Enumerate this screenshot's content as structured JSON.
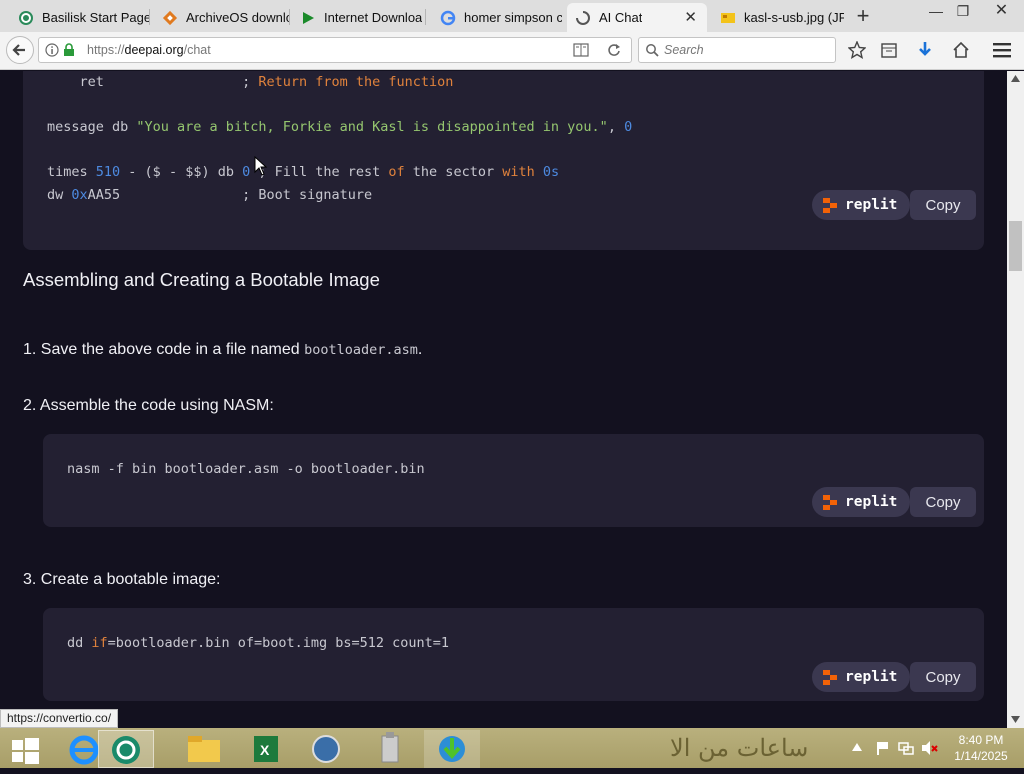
{
  "browser": {
    "tabs": [
      {
        "label": "Basilisk Start Page",
        "icon": "basilisk-icon"
      },
      {
        "label": "ArchiveOS downlo",
        "icon": "archiveos-icon"
      },
      {
        "label": "Internet Downloa",
        "icon": "play-icon"
      },
      {
        "label": "homer simpson c",
        "icon": "google-icon"
      },
      {
        "label": "AI Chat",
        "icon": "loading-icon",
        "active": true
      },
      {
        "label": "kasl-s-usb.jpg (JPE",
        "icon": "image-icon"
      }
    ],
    "new_tab": "+",
    "close_tab": "✕",
    "window_controls": {
      "minimize": "—",
      "restore": "❐",
      "close": "✕"
    },
    "url_prefix": "https://",
    "url_domain": "deepai.org",
    "url_path": "/chat",
    "search_placeholder": "Search"
  },
  "content": {
    "code_block_1": {
      "lines": [
        {
          "parts": [
            {
              "t": "    ret                 ",
              "c": "cm"
            },
            {
              "t": "; ",
              "c": "cm"
            },
            {
              "t": "Return ",
              "c": "kw"
            },
            {
              "t": "from ",
              "c": "kw"
            },
            {
              "t": "the ",
              "c": "kw"
            },
            {
              "t": "function",
              "c": "kw"
            }
          ]
        },
        {
          "parts": [
            {
              "t": "",
              "c": "cm"
            }
          ]
        },
        {
          "parts": [
            {
              "t": "message db ",
              "c": "cm"
            },
            {
              "t": "\"You are a bitch, Forkie and Kasl is disappointed in you.\"",
              "c": "str"
            },
            {
              "t": ", ",
              "c": "cm"
            },
            {
              "t": "0",
              "c": "num"
            }
          ]
        },
        {
          "parts": [
            {
              "t": "",
              "c": "cm"
            }
          ]
        },
        {
          "parts": [
            {
              "t": "times ",
              "c": "cm"
            },
            {
              "t": "510",
              "c": "num"
            },
            {
              "t": " - ($ - $$) db ",
              "c": "cm"
            },
            {
              "t": "0",
              "c": "num"
            },
            {
              "t": " ; Fill the rest ",
              "c": "cm"
            },
            {
              "t": "of",
              "c": "kw"
            },
            {
              "t": " the sector ",
              "c": "cm"
            },
            {
              "t": "with",
              "c": "kw"
            },
            {
              "t": " ",
              "c": "cm"
            },
            {
              "t": "0s",
              "c": "num"
            }
          ]
        },
        {
          "parts": [
            {
              "t": "dw ",
              "c": "cm"
            },
            {
              "t": "0x",
              "c": "num"
            },
            {
              "t": "AA55               ; Boot signature",
              "c": "cm"
            }
          ]
        }
      ]
    },
    "replit_label": "replit",
    "copy_label": "Copy",
    "section_heading": "Assembling and Creating a Bootable Image",
    "step1_text": "1. Save the above code in a file named ",
    "step1_code": "bootloader.asm",
    "step1_end": ".",
    "step2_text": "2. Assemble the code using NASM:",
    "code_block_2": "nasm -f bin bootloader.asm -o bootloader.bin",
    "step3_text": "3. Create a bootable image:",
    "code_block_3": {
      "pre": "dd ",
      "kw": "if",
      "post": "=bootloader.bin of=boot.img bs=512 count=1"
    }
  },
  "status_link": "https://convertio.co/",
  "taskbar": {
    "clock_time": "8:40 PM",
    "clock_date": "1/14/2025",
    "arabic_text": "ساعات من الا",
    "apps": [
      "start-icon",
      "ie-icon",
      "basilisk-icon",
      "file-explorer-icon",
      "excel-icon",
      "globe-icon",
      "usb-tool-icon",
      "idm-icon"
    ]
  }
}
